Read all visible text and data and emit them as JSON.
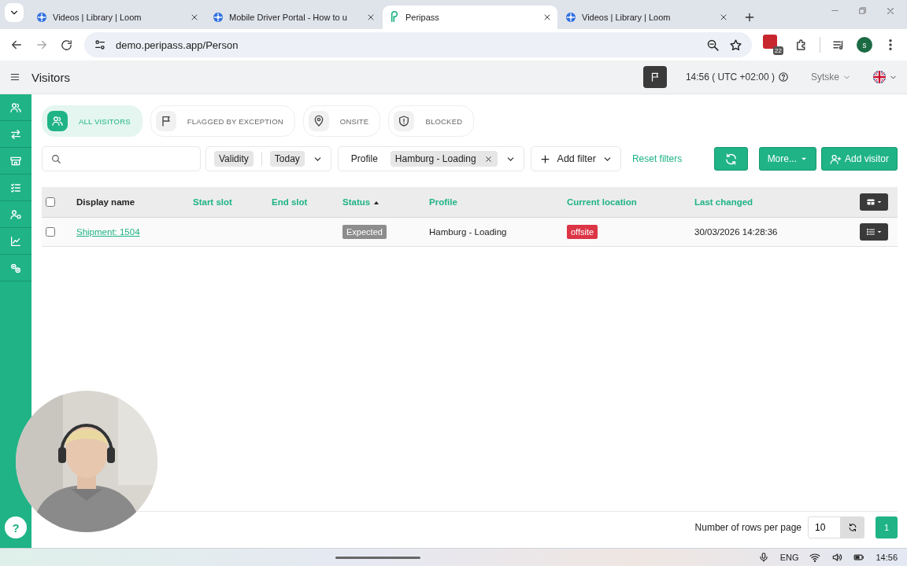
{
  "browser": {
    "tabs": [
      {
        "title": "Videos | Library | Loom",
        "selected": false
      },
      {
        "title": "Mobile Driver Portal - How to u",
        "selected": false
      },
      {
        "title": "Peripass",
        "selected": true
      },
      {
        "title": "Videos | Library | Loom",
        "selected": false
      }
    ],
    "url": "demo.peripass.app/Person",
    "extension_badge": "22",
    "profile_initial": "s"
  },
  "header": {
    "title": "Visitors",
    "time": "14:56 ( UTC +02:00 )",
    "user": "Sytske"
  },
  "categories": [
    {
      "label": "ALL VISITORS",
      "selected": true
    },
    {
      "label": "FLAGGED BY EXCEPTION",
      "selected": false
    },
    {
      "label": "ONSITE",
      "selected": false
    },
    {
      "label": "BLOCKED",
      "selected": false
    }
  ],
  "filters": [
    {
      "kind": "date",
      "label": "Validity",
      "value": "Today"
    },
    {
      "kind": "profile",
      "label": "Profile",
      "value": "Hamburg - Loading"
    }
  ],
  "add_filter": "Add filter",
  "reset_filters": "Reset filters",
  "actions": {
    "more": "More...",
    "add": "Add visitor"
  },
  "table": {
    "all_checked": false,
    "columns": [
      {
        "label": "Display name",
        "sortable": false,
        "sorted": false
      },
      {
        "label": "Start slot",
        "sortable": true,
        "sorted": false
      },
      {
        "label": "End slot",
        "sortable": true,
        "sorted": false
      },
      {
        "label": "Status",
        "sortable": true,
        "sorted": true
      },
      {
        "label": "Profile",
        "sortable": true,
        "sorted": false
      },
      {
        "label": "Current location",
        "sortable": true,
        "sorted": false
      },
      {
        "label": "Last changed",
        "sortable": true,
        "sorted": false
      }
    ],
    "rows": [
      {
        "checked": false,
        "display_name": "Shipment: 1504",
        "status": "Expected",
        "profile": "Hamburg - Loading",
        "current_location": "offsite",
        "last_changed": "30/03/2026 14:28:36"
      }
    ]
  },
  "pagination": {
    "rows_label": "Number of rows per page",
    "rows_per_page": "10",
    "pages": [
      {
        "label": "1",
        "selected": true
      }
    ]
  },
  "help": "?",
  "taskbar": {
    "language": "ENG",
    "time": "14:56"
  }
}
